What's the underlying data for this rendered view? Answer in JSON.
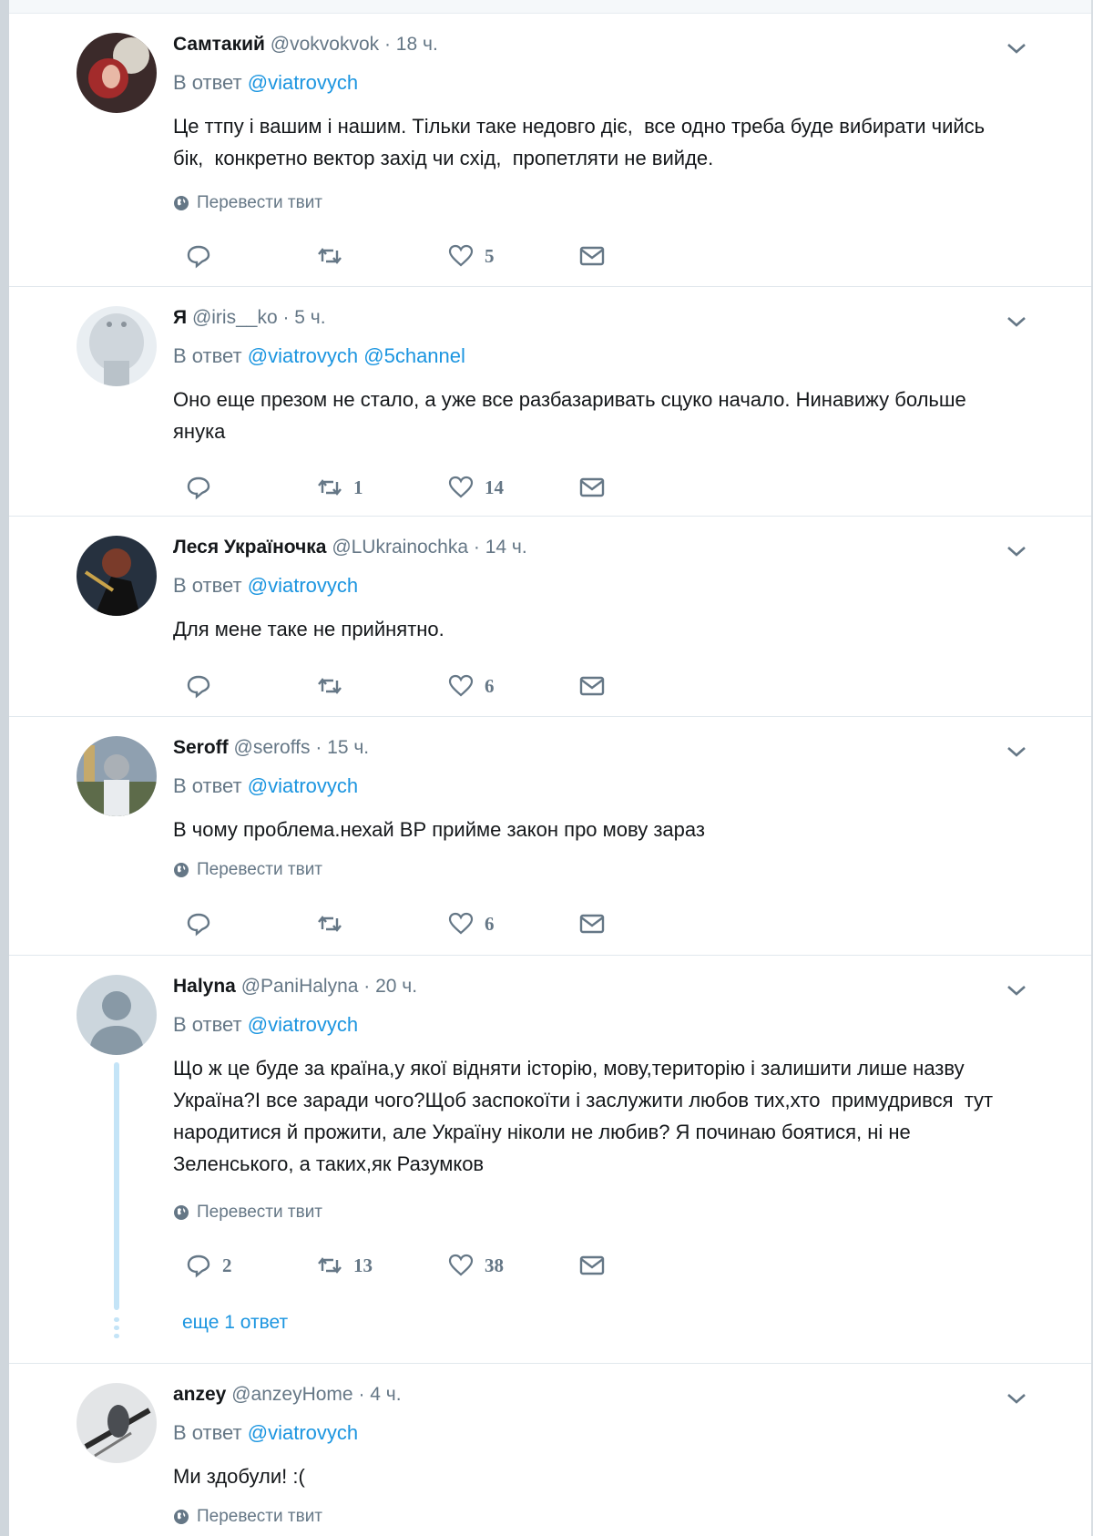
{
  "translate_label": "Перевести твит",
  "reply_prefix": "В ответ",
  "tweets": [
    {
      "name": "Самтакий",
      "handle": "@vokvokvok",
      "time": "· 18 ч.",
      "mentions": [
        "@viatrovych"
      ],
      "text": "Це ттпу і вашим і нашим. Тільки таке недовго діє,  все одно треба буде вибирати чийсь бік,  конкретно вектор захід чи схід,  пропетляти не вийде.",
      "replies": "",
      "retweets": "",
      "likes": "5"
    },
    {
      "name": "Я",
      "handle": "@iris__ko",
      "time": "· 5 ч.",
      "mentions": [
        "@viatrovych",
        "@5channel"
      ],
      "text": "Оно еще презом не стало, а уже все разбазаривать сцуко начало. Нинавижу больше янука",
      "replies": "",
      "retweets": "1",
      "likes": "14"
    },
    {
      "name": "Леся Україночка",
      "handle": "@LUkrainochka",
      "time": "· 14 ч.",
      "mentions": [
        "@viatrovych"
      ],
      "text": "Для мене таке не прийнятно.",
      "replies": "",
      "retweets": "",
      "likes": "6"
    },
    {
      "name": "Seroff",
      "handle": "@seroffs",
      "time": "· 15 ч.",
      "mentions": [
        "@viatrovych"
      ],
      "text": "В чому проблема.нехай ВР прийме закон про мову зараз",
      "replies": "",
      "retweets": "",
      "likes": "6"
    },
    {
      "name": "Halyna",
      "handle": "@PaniHalyna",
      "time": "· 20 ч.",
      "mentions": [
        "@viatrovych"
      ],
      "text": "Що ж це буде за країна,у якої відняти історію, мову,територію і залишити лише назву Україна?І все заради чого?Щоб заспокоїти і заслужити любов тих,хто  примудрився  тут народитися й прожити, але Україну ніколи не любив? Я починаю боятися, ні не Зеленського, а таких,як Разумков",
      "replies": "2",
      "retweets": "13",
      "likes": "38",
      "more_replies": "еще 1 ответ"
    },
    {
      "name": "anzey",
      "handle": "@anzeyHome",
      "time": "· 4 ч.",
      "mentions": [
        "@viatrovych"
      ],
      "text": "Ми здобули! :(",
      "replies": "",
      "retweets": "",
      "likes": ""
    }
  ]
}
